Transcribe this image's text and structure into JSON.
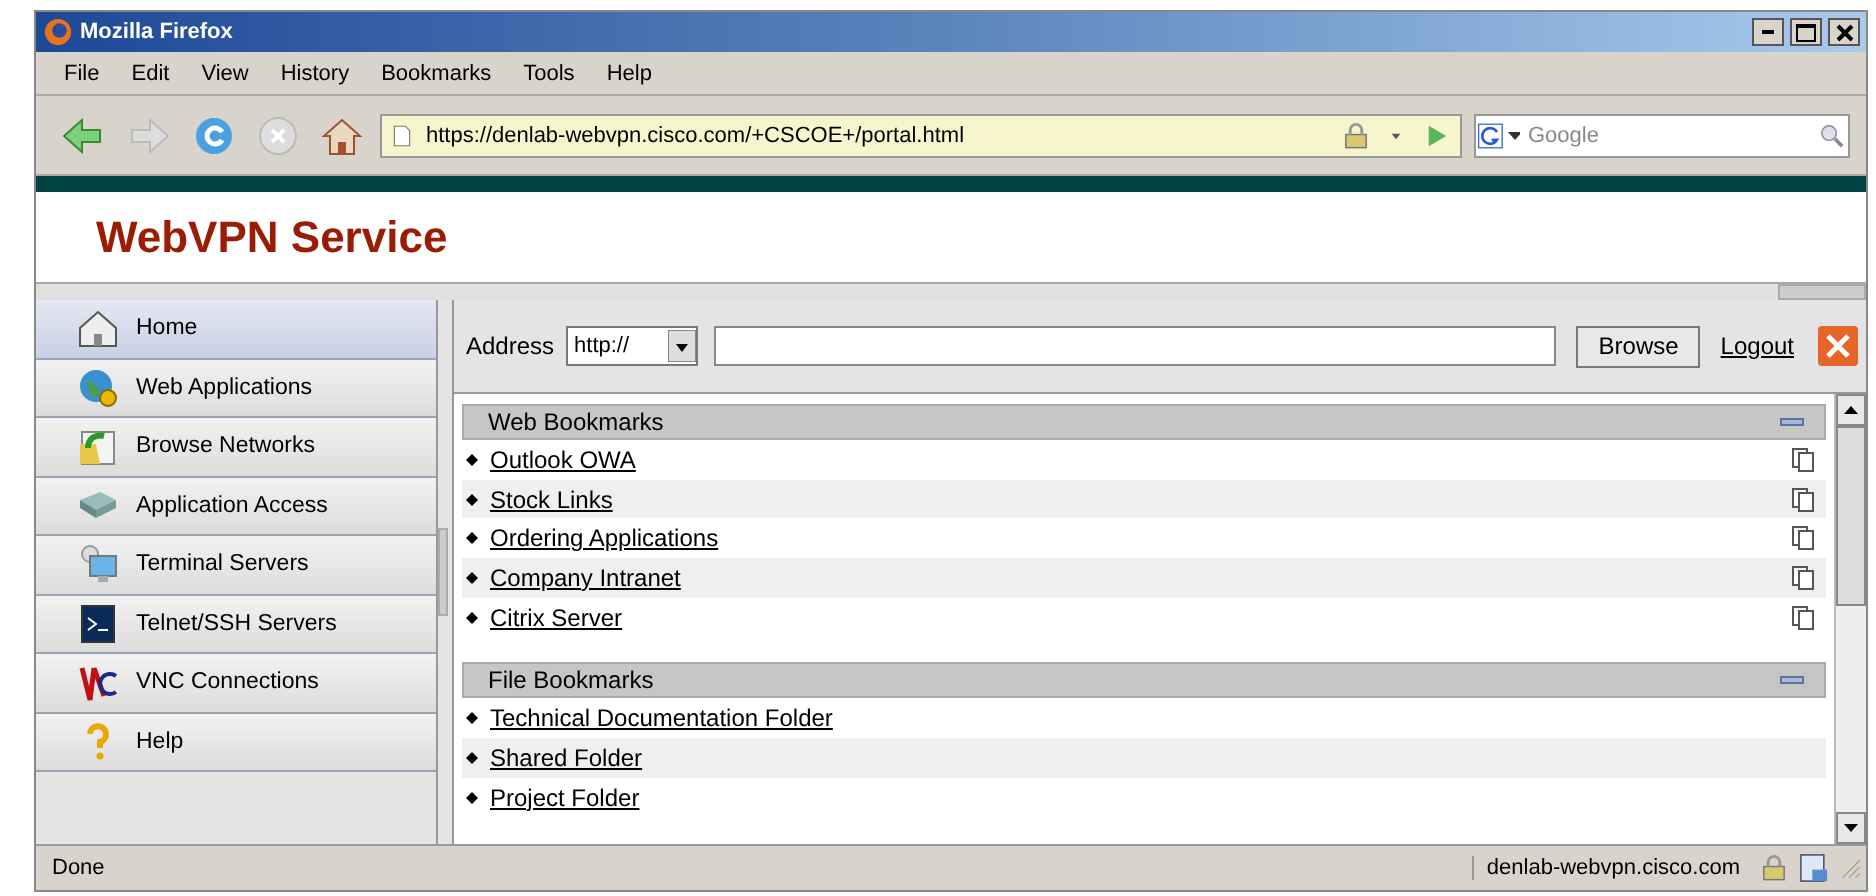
{
  "window": {
    "title": "Mozilla Firefox"
  },
  "menu": [
    "File",
    "Edit",
    "View",
    "History",
    "Bookmarks",
    "Tools",
    "Help"
  ],
  "navbar": {
    "url": "https://denlab-webvpn.cisco.com/+CSCOE+/portal.html",
    "search": {
      "placeholder": "Google"
    }
  },
  "header": {
    "title": "WebVPN Service"
  },
  "sidebar": {
    "items": [
      {
        "label": "Home",
        "kind": "home",
        "selected": true
      },
      {
        "label": "Web Applications",
        "kind": "globe",
        "selected": false
      },
      {
        "label": "Browse Networks",
        "kind": "folder",
        "selected": false
      },
      {
        "label": "Application Access",
        "kind": "cables",
        "selected": false
      },
      {
        "label": "Terminal Servers",
        "kind": "monitor",
        "selected": false
      },
      {
        "label": "Telnet/SSH Servers",
        "kind": "terminal",
        "selected": false
      },
      {
        "label": "VNC Connections",
        "kind": "vnc",
        "selected": false
      },
      {
        "label": "Help",
        "kind": "help",
        "selected": false
      }
    ]
  },
  "address_bar": {
    "label": "Address",
    "protocol": "http://",
    "button": "Browse",
    "logout": "Logout"
  },
  "sections": [
    {
      "title": "Web Bookmarks",
      "expanded": true,
      "items": [
        {
          "label": "Outlook OWA",
          "copy": true
        },
        {
          "label": "Stock Links",
          "copy": true
        },
        {
          "label": "Ordering Applications",
          "copy": true
        },
        {
          "label": "Company Intranet",
          "copy": true
        },
        {
          "label": "Citrix Server",
          "copy": true
        }
      ]
    },
    {
      "title": "File Bookmarks",
      "expanded": true,
      "items": [
        {
          "label": "Technical Documentation Folder",
          "copy": false
        },
        {
          "label": "Shared Folder",
          "copy": false
        },
        {
          "label": "Project Folder",
          "copy": false
        }
      ]
    }
  ],
  "status_bar": {
    "text": "Done",
    "host": "denlab-webvpn.cisco.com"
  }
}
